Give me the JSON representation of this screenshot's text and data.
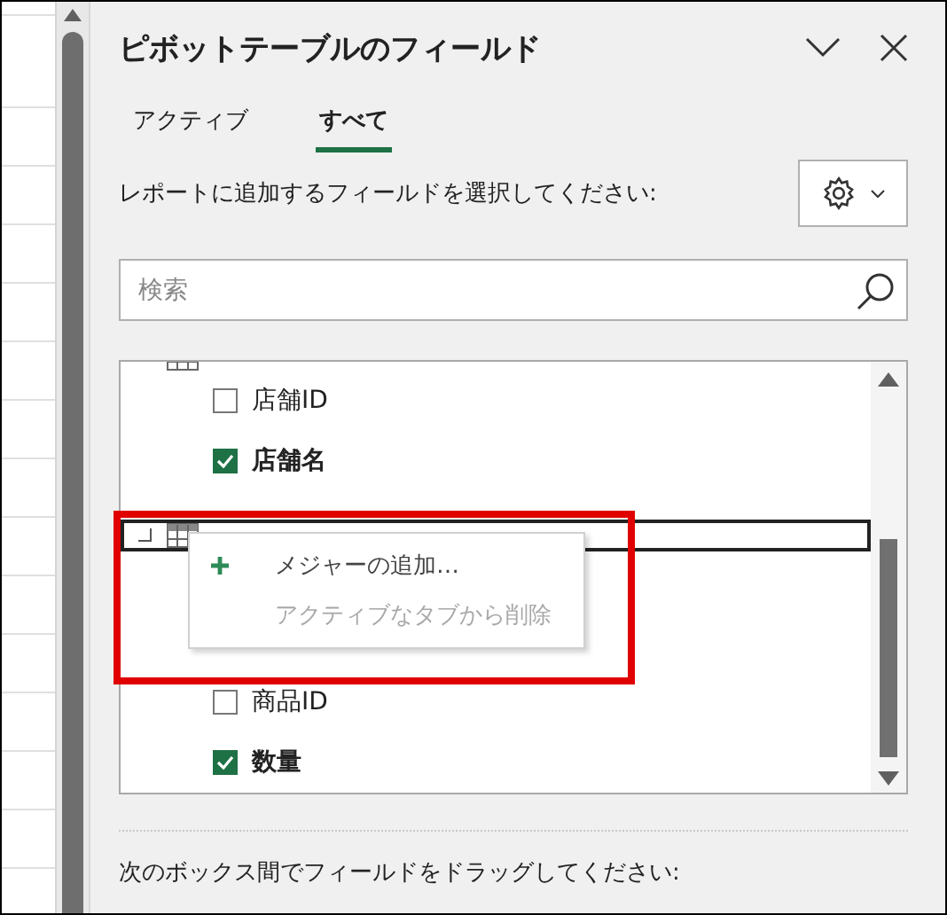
{
  "panel": {
    "title": "ピボットテーブルのフィールド"
  },
  "tabs": [
    {
      "label": "アクティブ",
      "selected": false
    },
    {
      "label": "すべて",
      "selected": true
    }
  ],
  "prompt": "レポートに追加するフィールドを選択してください:",
  "search": {
    "placeholder": "検索"
  },
  "fields": [
    {
      "kind": "table-cut"
    },
    {
      "kind": "field",
      "label": "店舗ID",
      "checked": false
    },
    {
      "kind": "field",
      "label": "店舗名",
      "checked": true
    },
    {
      "kind": "table",
      "highlighted": true
    },
    {
      "kind": "covered"
    },
    {
      "kind": "field",
      "label": "商品ID",
      "checked": false
    },
    {
      "kind": "field",
      "label": "数量",
      "checked": true
    }
  ],
  "context_menu": [
    {
      "label": "メジャーの追加…",
      "disabled": false
    },
    {
      "label": "アクティブなタブから削除",
      "disabled": true
    }
  ],
  "footer": "次のボックス間でフィールドをドラッグしてください:"
}
